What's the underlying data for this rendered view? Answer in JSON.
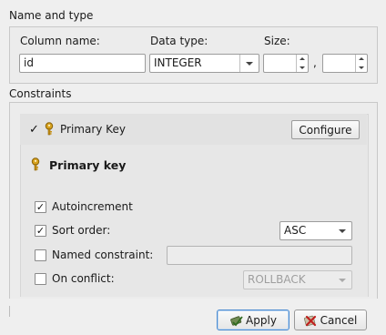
{
  "name_section": {
    "title": "Name and type",
    "column_name_label": "Column name:",
    "column_name_value": "id",
    "data_type_label": "Data type:",
    "data_type_value": "INTEGER",
    "size_label": "Size:",
    "size_value_1": "",
    "size_separator": ",",
    "size_value_2": ""
  },
  "constraints_section": {
    "title": "Constraints",
    "primary_key_label": "Primary Key",
    "primary_key_checked": true,
    "configure_label": "Configure",
    "panel_title": "Primary key",
    "autoincrement_label": "Autoincrement",
    "autoincrement_checked": true,
    "sort_order_label": "Sort order:",
    "sort_order_checked": true,
    "sort_order_value": "ASC",
    "named_constraint_label": "Named constraint:",
    "named_constraint_checked": false,
    "named_constraint_value": "",
    "on_conflict_label": "On conflict:",
    "on_conflict_checked": false,
    "on_conflict_value": "ROLLBACK"
  },
  "buttons": {
    "apply_label": "Apply",
    "cancel_label": "Cancel"
  },
  "icons": {
    "key": "key-icon",
    "apply": "apply-icon",
    "cancel": "cancel-icon"
  }
}
